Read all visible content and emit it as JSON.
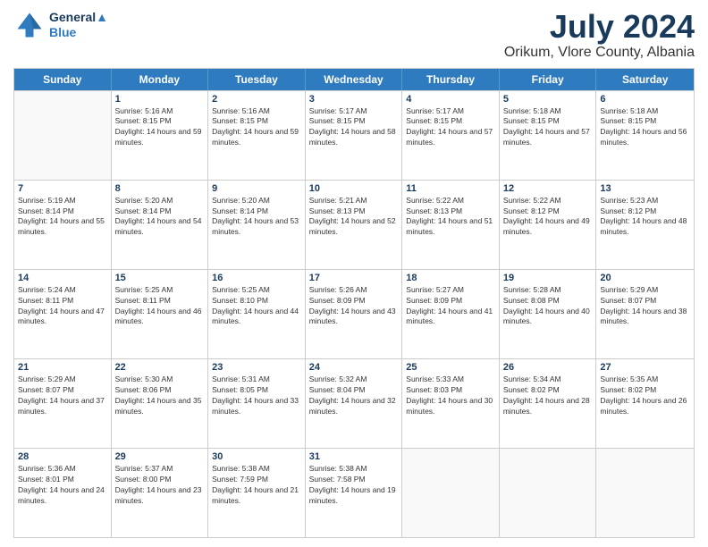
{
  "logo": {
    "line1": "General",
    "line2": "Blue"
  },
  "title": "July 2024",
  "subtitle": "Orikum, Vlore County, Albania",
  "header_days": [
    "Sunday",
    "Monday",
    "Tuesday",
    "Wednesday",
    "Thursday",
    "Friday",
    "Saturday"
  ],
  "weeks": [
    [
      {
        "day": "",
        "sunrise": "",
        "sunset": "",
        "daylight": ""
      },
      {
        "day": "1",
        "sunrise": "Sunrise: 5:16 AM",
        "sunset": "Sunset: 8:15 PM",
        "daylight": "Daylight: 14 hours and 59 minutes."
      },
      {
        "day": "2",
        "sunrise": "Sunrise: 5:16 AM",
        "sunset": "Sunset: 8:15 PM",
        "daylight": "Daylight: 14 hours and 59 minutes."
      },
      {
        "day": "3",
        "sunrise": "Sunrise: 5:17 AM",
        "sunset": "Sunset: 8:15 PM",
        "daylight": "Daylight: 14 hours and 58 minutes."
      },
      {
        "day": "4",
        "sunrise": "Sunrise: 5:17 AM",
        "sunset": "Sunset: 8:15 PM",
        "daylight": "Daylight: 14 hours and 57 minutes."
      },
      {
        "day": "5",
        "sunrise": "Sunrise: 5:18 AM",
        "sunset": "Sunset: 8:15 PM",
        "daylight": "Daylight: 14 hours and 57 minutes."
      },
      {
        "day": "6",
        "sunrise": "Sunrise: 5:18 AM",
        "sunset": "Sunset: 8:15 PM",
        "daylight": "Daylight: 14 hours and 56 minutes."
      }
    ],
    [
      {
        "day": "7",
        "sunrise": "Sunrise: 5:19 AM",
        "sunset": "Sunset: 8:14 PM",
        "daylight": "Daylight: 14 hours and 55 minutes."
      },
      {
        "day": "8",
        "sunrise": "Sunrise: 5:20 AM",
        "sunset": "Sunset: 8:14 PM",
        "daylight": "Daylight: 14 hours and 54 minutes."
      },
      {
        "day": "9",
        "sunrise": "Sunrise: 5:20 AM",
        "sunset": "Sunset: 8:14 PM",
        "daylight": "Daylight: 14 hours and 53 minutes."
      },
      {
        "day": "10",
        "sunrise": "Sunrise: 5:21 AM",
        "sunset": "Sunset: 8:13 PM",
        "daylight": "Daylight: 14 hours and 52 minutes."
      },
      {
        "day": "11",
        "sunrise": "Sunrise: 5:22 AM",
        "sunset": "Sunset: 8:13 PM",
        "daylight": "Daylight: 14 hours and 51 minutes."
      },
      {
        "day": "12",
        "sunrise": "Sunrise: 5:22 AM",
        "sunset": "Sunset: 8:12 PM",
        "daylight": "Daylight: 14 hours and 49 minutes."
      },
      {
        "day": "13",
        "sunrise": "Sunrise: 5:23 AM",
        "sunset": "Sunset: 8:12 PM",
        "daylight": "Daylight: 14 hours and 48 minutes."
      }
    ],
    [
      {
        "day": "14",
        "sunrise": "Sunrise: 5:24 AM",
        "sunset": "Sunset: 8:11 PM",
        "daylight": "Daylight: 14 hours and 47 minutes."
      },
      {
        "day": "15",
        "sunrise": "Sunrise: 5:25 AM",
        "sunset": "Sunset: 8:11 PM",
        "daylight": "Daylight: 14 hours and 46 minutes."
      },
      {
        "day": "16",
        "sunrise": "Sunrise: 5:25 AM",
        "sunset": "Sunset: 8:10 PM",
        "daylight": "Daylight: 14 hours and 44 minutes."
      },
      {
        "day": "17",
        "sunrise": "Sunrise: 5:26 AM",
        "sunset": "Sunset: 8:09 PM",
        "daylight": "Daylight: 14 hours and 43 minutes."
      },
      {
        "day": "18",
        "sunrise": "Sunrise: 5:27 AM",
        "sunset": "Sunset: 8:09 PM",
        "daylight": "Daylight: 14 hours and 41 minutes."
      },
      {
        "day": "19",
        "sunrise": "Sunrise: 5:28 AM",
        "sunset": "Sunset: 8:08 PM",
        "daylight": "Daylight: 14 hours and 40 minutes."
      },
      {
        "day": "20",
        "sunrise": "Sunrise: 5:29 AM",
        "sunset": "Sunset: 8:07 PM",
        "daylight": "Daylight: 14 hours and 38 minutes."
      }
    ],
    [
      {
        "day": "21",
        "sunrise": "Sunrise: 5:29 AM",
        "sunset": "Sunset: 8:07 PM",
        "daylight": "Daylight: 14 hours and 37 minutes."
      },
      {
        "day": "22",
        "sunrise": "Sunrise: 5:30 AM",
        "sunset": "Sunset: 8:06 PM",
        "daylight": "Daylight: 14 hours and 35 minutes."
      },
      {
        "day": "23",
        "sunrise": "Sunrise: 5:31 AM",
        "sunset": "Sunset: 8:05 PM",
        "daylight": "Daylight: 14 hours and 33 minutes."
      },
      {
        "day": "24",
        "sunrise": "Sunrise: 5:32 AM",
        "sunset": "Sunset: 8:04 PM",
        "daylight": "Daylight: 14 hours and 32 minutes."
      },
      {
        "day": "25",
        "sunrise": "Sunrise: 5:33 AM",
        "sunset": "Sunset: 8:03 PM",
        "daylight": "Daylight: 14 hours and 30 minutes."
      },
      {
        "day": "26",
        "sunrise": "Sunrise: 5:34 AM",
        "sunset": "Sunset: 8:02 PM",
        "daylight": "Daylight: 14 hours and 28 minutes."
      },
      {
        "day": "27",
        "sunrise": "Sunrise: 5:35 AM",
        "sunset": "Sunset: 8:02 PM",
        "daylight": "Daylight: 14 hours and 26 minutes."
      }
    ],
    [
      {
        "day": "28",
        "sunrise": "Sunrise: 5:36 AM",
        "sunset": "Sunset: 8:01 PM",
        "daylight": "Daylight: 14 hours and 24 minutes."
      },
      {
        "day": "29",
        "sunrise": "Sunrise: 5:37 AM",
        "sunset": "Sunset: 8:00 PM",
        "daylight": "Daylight: 14 hours and 23 minutes."
      },
      {
        "day": "30",
        "sunrise": "Sunrise: 5:38 AM",
        "sunset": "Sunset: 7:59 PM",
        "daylight": "Daylight: 14 hours and 21 minutes."
      },
      {
        "day": "31",
        "sunrise": "Sunrise: 5:38 AM",
        "sunset": "Sunset: 7:58 PM",
        "daylight": "Daylight: 14 hours and 19 minutes."
      },
      {
        "day": "",
        "sunrise": "",
        "sunset": "",
        "daylight": ""
      },
      {
        "day": "",
        "sunrise": "",
        "sunset": "",
        "daylight": ""
      },
      {
        "day": "",
        "sunrise": "",
        "sunset": "",
        "daylight": ""
      }
    ]
  ]
}
